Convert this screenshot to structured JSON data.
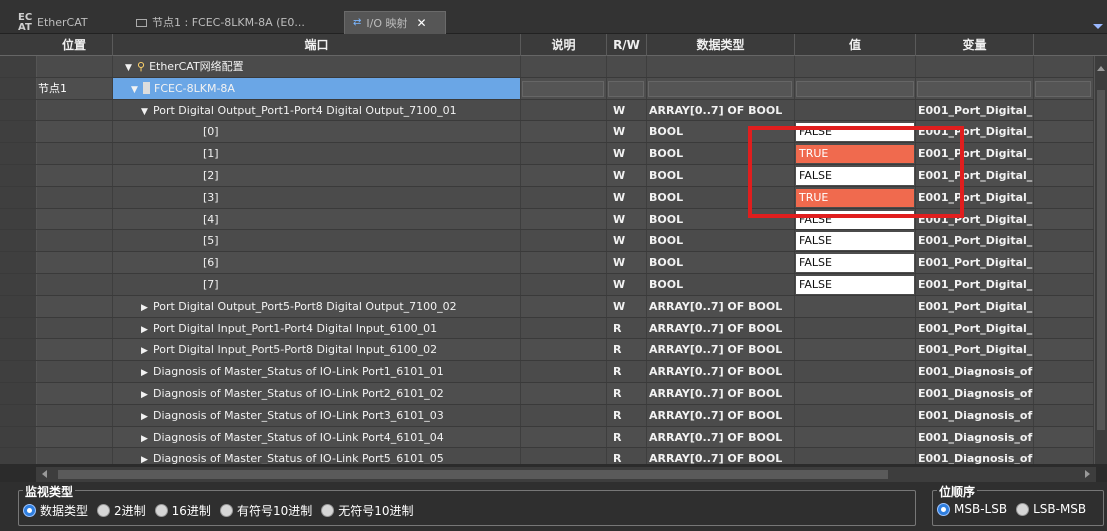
{
  "tabs": [
    {
      "label": "EtherCAT",
      "icon": "ethercat-icon"
    },
    {
      "label": "节点1 : FCEC-8LKM-8A (E0...",
      "icon": "node-icon"
    },
    {
      "label": "I/O 映射",
      "icon": "io-map-icon",
      "active": true
    }
  ],
  "columns": {
    "position": "位置",
    "port": "端口",
    "description": "说明",
    "rw": "R/W",
    "datatype": "数据类型",
    "value": "值",
    "variable": "变量"
  },
  "rows": [
    {
      "kind": "network",
      "pos": "",
      "port": "EtherCAT网络配置",
      "rw": "",
      "type": "",
      "value": "",
      "var": ""
    },
    {
      "kind": "device",
      "pos": "节点1",
      "port": "FCEC-8LKM-8A",
      "rw": "",
      "type": "",
      "value": "",
      "var": ""
    },
    {
      "kind": "group-open",
      "pos": "",
      "port": "Port Digital Output_Port1-Port4 Digital Output_7100_01",
      "rw": "W",
      "type": "ARRAY[0..7] OF BOOL",
      "value": "",
      "var": "E001_Port_Digital_"
    },
    {
      "kind": "item",
      "pos": "",
      "port": "[0]",
      "rw": "W",
      "type": "BOOL",
      "value": "FALSE",
      "var": "E001_Port_Digital_"
    },
    {
      "kind": "item",
      "pos": "",
      "port": "[1]",
      "rw": "W",
      "type": "BOOL",
      "value": "TRUE",
      "var": "E001_Port_Digital_"
    },
    {
      "kind": "item",
      "pos": "",
      "port": "[2]",
      "rw": "W",
      "type": "BOOL",
      "value": "FALSE",
      "var": "E001_Port_Digital_"
    },
    {
      "kind": "item",
      "pos": "",
      "port": "[3]",
      "rw": "W",
      "type": "BOOL",
      "value": "TRUE",
      "var": "E001_Port_Digital_"
    },
    {
      "kind": "item",
      "pos": "",
      "port": "[4]",
      "rw": "W",
      "type": "BOOL",
      "value": "FALSE",
      "var": "E001_Port_Digital_"
    },
    {
      "kind": "item",
      "pos": "",
      "port": "[5]",
      "rw": "W",
      "type": "BOOL",
      "value": "FALSE",
      "var": "E001_Port_Digital_"
    },
    {
      "kind": "item",
      "pos": "",
      "port": "[6]",
      "rw": "W",
      "type": "BOOL",
      "value": "FALSE",
      "var": "E001_Port_Digital_"
    },
    {
      "kind": "item",
      "pos": "",
      "port": "[7]",
      "rw": "W",
      "type": "BOOL",
      "value": "FALSE",
      "var": "E001_Port_Digital_"
    },
    {
      "kind": "group-closed",
      "pos": "",
      "port": "Port Digital Output_Port5-Port8 Digital Output_7100_02",
      "rw": "W",
      "type": "ARRAY[0..7] OF BOOL",
      "value": "",
      "var": "E001_Port_Digital_"
    },
    {
      "kind": "group-closed",
      "pos": "",
      "port": "Port Digital Input_Port1-Port4 Digital Input_6100_01",
      "rw": "R",
      "type": "ARRAY[0..7] OF BOOL",
      "value": "",
      "var": "E001_Port_Digital_"
    },
    {
      "kind": "group-closed",
      "pos": "",
      "port": "Port Digital Input_Port5-Port8 Digital Input_6100_02",
      "rw": "R",
      "type": "ARRAY[0..7] OF BOOL",
      "value": "",
      "var": "E001_Port_Digital_"
    },
    {
      "kind": "group-closed",
      "pos": "",
      "port": "Diagnosis of Master_Status of IO-Link Port1_6101_01",
      "rw": "R",
      "type": "ARRAY[0..7] OF BOOL",
      "value": "",
      "var": "E001_Diagnosis_of"
    },
    {
      "kind": "group-closed",
      "pos": "",
      "port": "Diagnosis of Master_Status of IO-Link Port2_6101_02",
      "rw": "R",
      "type": "ARRAY[0..7] OF BOOL",
      "value": "",
      "var": "E001_Diagnosis_of"
    },
    {
      "kind": "group-closed",
      "pos": "",
      "port": "Diagnosis of Master_Status of IO-Link Port3_6101_03",
      "rw": "R",
      "type": "ARRAY[0..7] OF BOOL",
      "value": "",
      "var": "E001_Diagnosis_of"
    },
    {
      "kind": "group-closed",
      "pos": "",
      "port": "Diagnosis of Master_Status of IO-Link Port4_6101_04",
      "rw": "R",
      "type": "ARRAY[0..7] OF BOOL",
      "value": "",
      "var": "E001_Diagnosis_of"
    },
    {
      "kind": "group-closed",
      "pos": "",
      "port": "Diagnosis of Master_Status of IO-Link Port5_6101_05",
      "rw": "R",
      "type": "ARRAY[0..7] OF BOOL",
      "value": "",
      "var": "E001_Diagnosis_of"
    }
  ],
  "monitor": {
    "legend": "监视类型",
    "options": [
      {
        "label": "数据类型",
        "selected": true
      },
      {
        "label": "2进制",
        "selected": false
      },
      {
        "label": "16进制",
        "selected": false
      },
      {
        "label": "有符号10进制",
        "selected": false
      },
      {
        "label": "无符号10进制",
        "selected": false
      }
    ]
  },
  "bitorder": {
    "legend": "位顺序",
    "options": [
      {
        "label": "MSB-LSB",
        "selected": true
      },
      {
        "label": "LSB-MSB",
        "selected": false
      }
    ]
  },
  "colors": {
    "true_bg": "#f06a4e",
    "false_bg": "#ffffff",
    "highlight": "#e01e1e",
    "selection": "#6aa6e6"
  }
}
